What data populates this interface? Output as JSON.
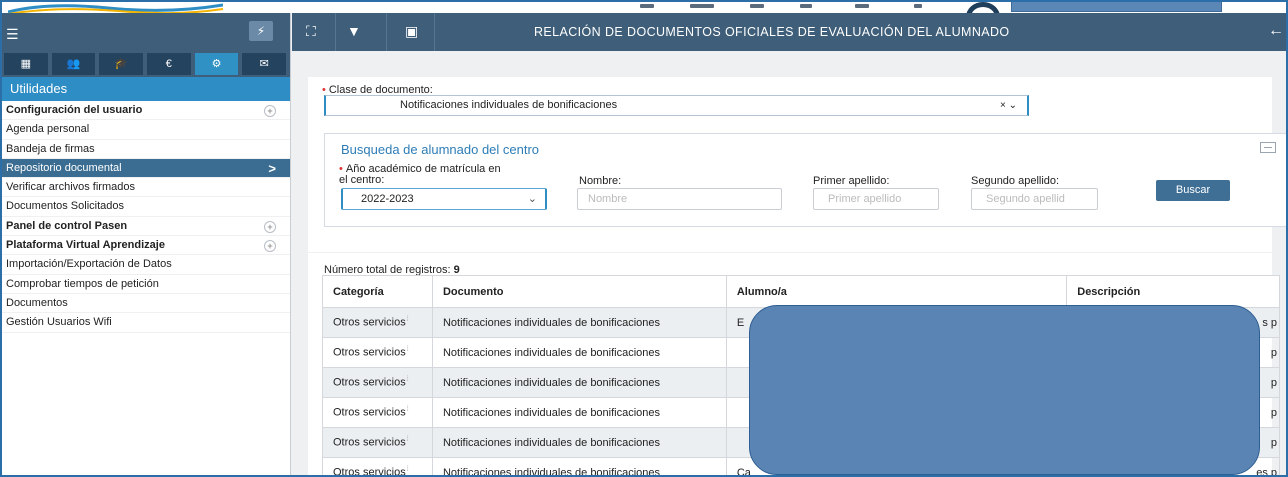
{
  "colors": {
    "header_bg": "#3e5e79",
    "accent": "#2e8dc4",
    "active_item": "#3b6d92",
    "button": "#3f6f95",
    "redaction": "#5a84b3"
  },
  "sidebar": {
    "section_title": "Utilidades",
    "tabs": [
      {
        "icon": "calendar-icon",
        "glyph": "▦"
      },
      {
        "icon": "users-icon",
        "glyph": "👥"
      },
      {
        "icon": "graduation-cap-icon",
        "glyph": "🎓"
      },
      {
        "icon": "euro-icon",
        "glyph": "€"
      },
      {
        "icon": "gears-icon",
        "glyph": "⚙"
      },
      {
        "icon": "mail-icon",
        "glyph": "✉"
      }
    ],
    "items": [
      {
        "label": "Configuración del usuario",
        "bold": true,
        "expandable": true
      },
      {
        "label": "Agenda personal"
      },
      {
        "label": "Bandeja de firmas"
      },
      {
        "label": "Repositorio documental",
        "active": true
      },
      {
        "label": "Verificar archivos firmados"
      },
      {
        "label": "Documentos Solicitados"
      },
      {
        "label": "Panel de control Pasen",
        "bold": true,
        "expandable": true
      },
      {
        "label": "Plataforma Virtual Aprendizaje",
        "bold": true,
        "expandable": true
      },
      {
        "label": "Importación/Exportación de Datos"
      },
      {
        "label": "Comprobar tiempos de petición"
      },
      {
        "label": "Documentos"
      },
      {
        "label": "Gestión Usuarios Wifi"
      }
    ]
  },
  "header": {
    "title": "RELACIÓN DE DOCUMENTOS OFICIALES DE EVALUACIÓN DEL ALUMNADO"
  },
  "filters": {
    "doc_class_label": "Clase de documento:",
    "doc_class_value": "Notificaciones individuales de bonificaciones",
    "search_title": "Busqueda de alumnado del centro",
    "year_label_line1": "Año académico de matrícula en",
    "year_label_line2": "el centro:",
    "year_value": "2022-2023",
    "name_label": "Nombre:",
    "name_placeholder": "Nombre",
    "surname1_label": "Primer apellido:",
    "surname1_placeholder": "Primer apellido",
    "surname2_label": "Segundo apellido:",
    "surname2_placeholder": "Segundo apellid",
    "search_button": "Buscar"
  },
  "results": {
    "count_label": "Número total de registros:",
    "count_value": "9",
    "columns": [
      "Categoría",
      "Documento",
      "Alumno/a",
      "Descripción"
    ],
    "rows": [
      {
        "categoria": "Otros servicios",
        "documento": "Notificaciones individuales de bonificaciones",
        "alumno": "E",
        "descripcion": "s p"
      },
      {
        "categoria": "Otros servicios",
        "documento": "Notificaciones individuales de bonificaciones",
        "alumno": "",
        "descripcion": "p"
      },
      {
        "categoria": "Otros servicios",
        "documento": "Notificaciones individuales de bonificaciones",
        "alumno": "",
        "descripcion": "p"
      },
      {
        "categoria": "Otros servicios",
        "documento": "Notificaciones individuales de bonificaciones",
        "alumno": "",
        "descripcion": "p"
      },
      {
        "categoria": "Otros servicios",
        "documento": "Notificaciones individuales de bonificaciones",
        "alumno": "",
        "descripcion": "p"
      },
      {
        "categoria": "Otros servicios",
        "documento": "Notificaciones individuales de bonificaciones",
        "alumno": "Ca",
        "descripcion": "es p"
      }
    ]
  }
}
